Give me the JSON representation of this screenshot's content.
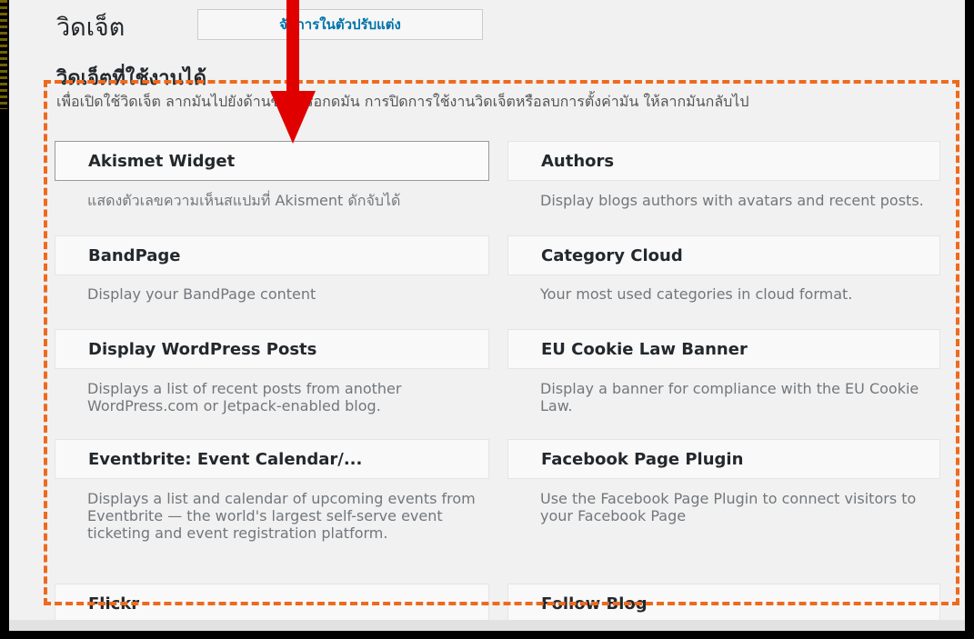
{
  "header": {
    "title": "วิดเจ็ต",
    "manage_label": "จัดการในตัวปรับแต่ง"
  },
  "available": {
    "heading": "วิดเจ็ตที่ใช้งานได้",
    "description": "เพื่อเปิดใช้วิดเจ็ต ลากมันไปยังด้านข้างหรือกดมัน การปิดการใช้งานวิดเจ็ตหรือลบการตั้งค่ามัน ให้ลากมันกลับไป"
  },
  "widgets": [
    {
      "title": "Akismet Widget",
      "desc": "แสดงตัวเลขความเห็นสแปมที่ Akisment ดักจับได้"
    },
    {
      "title": "Authors",
      "desc": "Display blogs authors with avatars and recent posts."
    },
    {
      "title": "BandPage",
      "desc": "Display your BandPage content"
    },
    {
      "title": "Category Cloud",
      "desc": "Your most used categories in cloud format."
    },
    {
      "title": "Display WordPress Posts",
      "desc": "Displays a list of recent posts from another WordPress.com or Jetpack-enabled blog."
    },
    {
      "title": "EU Cookie Law Banner",
      "desc": "Display a banner for compliance with the EU Cookie Law."
    },
    {
      "title": "Eventbrite: Event Calendar/...",
      "desc": "Displays a list and calendar of upcoming events from Eventbrite — the world's largest self-serve event ticketing and event registration platform."
    },
    {
      "title": "Facebook Page Plugin",
      "desc": "Use the Facebook Page Plugin to connect visitors to your Facebook Page"
    },
    {
      "title": "Flickr",
      "desc": ""
    },
    {
      "title": "Follow Blog",
      "desc": ""
    }
  ],
  "colors": {
    "annotation_orange": "#ee6a1e",
    "arrow_red": "#e00000",
    "link_blue": "#0073aa"
  }
}
